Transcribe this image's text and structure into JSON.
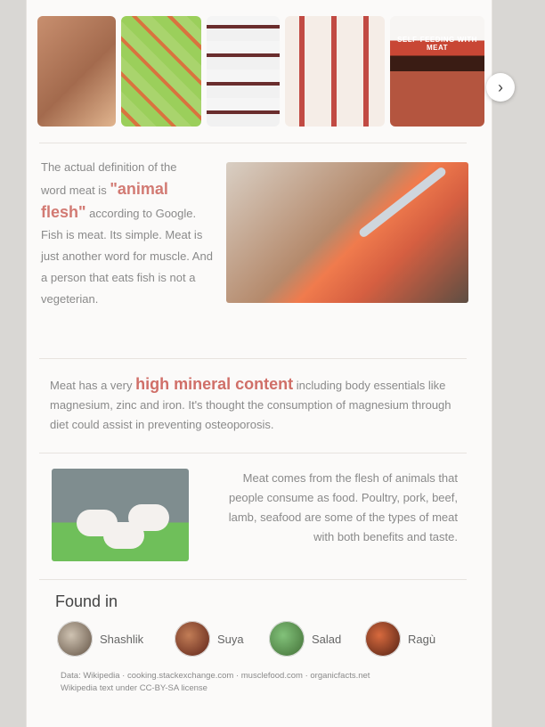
{
  "carousel": {
    "thumbs": [
      {
        "name": "meat-cuts-image"
      },
      {
        "name": "meat-pattern-image"
      },
      {
        "name": "meat-chart-image"
      },
      {
        "name": "meat-varieties-image"
      },
      {
        "name": "steak-book-image",
        "label": "SELF-FEEDING WITH MEAT"
      }
    ],
    "next_icon": "chevron-right-icon"
  },
  "section1": {
    "t1": "The actual definition of the",
    "t2": "word meat is ",
    "hl": "\"animal flesh\"",
    "t3": " according to Google. Fish is meat. Its simple. Meat is just another word for muscle. And a person that eats fish is not a vegeterian."
  },
  "section2": {
    "t1": "Meat has a very ",
    "hl": "high mineral content",
    "t2": " including body essentials like magnesium, zinc and iron. It's thought the consumption of magnesium through diet could assist in preventing osteoporosis."
  },
  "section3": {
    "text": "Meat comes from the flesh of animals that people consume as food. Poultry, pork, beef, lamb, seafood are some of the types of meat with both benefits and taste."
  },
  "found_in": {
    "title": "Found in",
    "dishes": [
      {
        "label": "Shashlik"
      },
      {
        "label": "Suya"
      },
      {
        "label": "Salad"
      },
      {
        "label": "Ragù"
      }
    ]
  },
  "footer": {
    "line1": "Data: Wikipedia · cooking.stackexchange.com · musclefood.com · organicfacts.net",
    "line2": "Wikipedia text under CC-BY-SA license"
  }
}
